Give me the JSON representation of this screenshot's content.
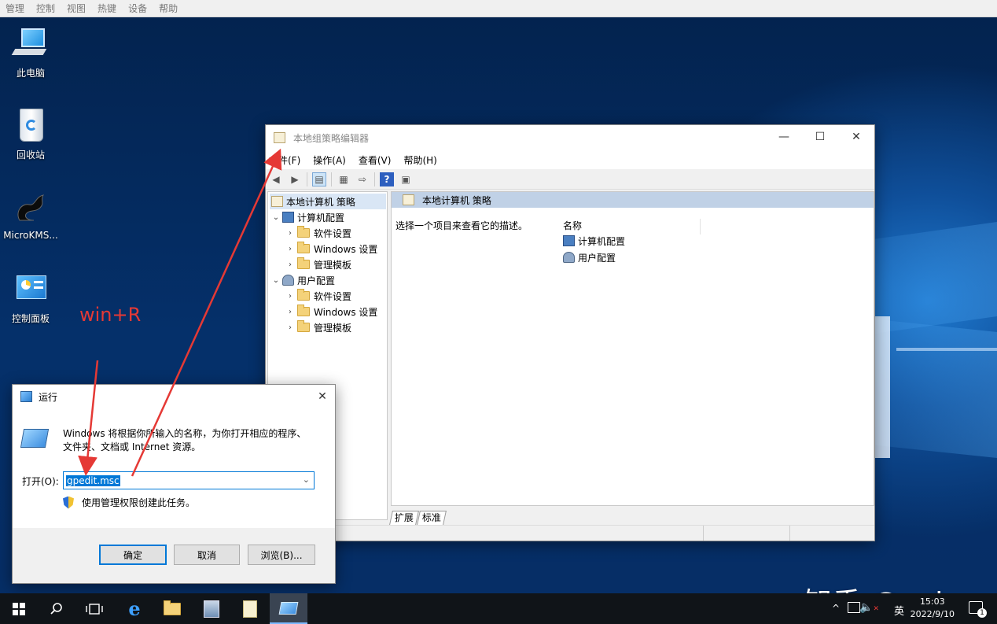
{
  "vm_menu": [
    "管理",
    "控制",
    "视图",
    "热键",
    "设备",
    "帮助"
  ],
  "desktop_icons": [
    {
      "label": "此电脑",
      "icon": "computer-icon"
    },
    {
      "label": "回收站",
      "icon": "recycle-bin-icon"
    },
    {
      "label": "MicroKMS...",
      "icon": "dragon-icon"
    },
    {
      "label": "控制面板",
      "icon": "control-panel-icon"
    }
  ],
  "annotation": "win+R",
  "gpedit": {
    "title": "本地组策略编辑器",
    "menu": [
      "文件(F)",
      "操作(A)",
      "查看(V)",
      "帮助(H)"
    ],
    "tree": [
      {
        "label": "本地计算机 策略",
        "level": 0
      },
      {
        "label": "计算机配置",
        "level": 1
      },
      {
        "label": "软件设置",
        "level": 2
      },
      {
        "label": "Windows 设置",
        "level": 2
      },
      {
        "label": "管理模板",
        "level": 2
      },
      {
        "label": "用户配置",
        "level": 1
      },
      {
        "label": "软件设置",
        "level": 2
      },
      {
        "label": "Windows 设置",
        "level": 2
      },
      {
        "label": "管理模板",
        "level": 2
      }
    ],
    "content_header": "本地计算机 策略",
    "description": "选择一个项目来查看它的描述。",
    "column_name": "名称",
    "items": [
      "计算机配置",
      "用户配置"
    ],
    "tabs": [
      "扩展",
      "标准"
    ]
  },
  "run": {
    "title": "运行",
    "desc_line1": "Windows 将根据你所输入的名称，为你打开相应的程序、",
    "desc_line2": "文件夹、文档或 Internet 资源。",
    "open_label": "打开(O):",
    "input_value": "gpedit.msc",
    "admin_text": "使用管理权限创建此任务。",
    "ok": "确定",
    "cancel": "取消",
    "browse": "浏览(B)..."
  },
  "taskbar": {
    "time": "15:03",
    "date": "2022/9/10",
    "ime": "英",
    "notification_count": "1"
  },
  "watermark": "知乎 @echo"
}
